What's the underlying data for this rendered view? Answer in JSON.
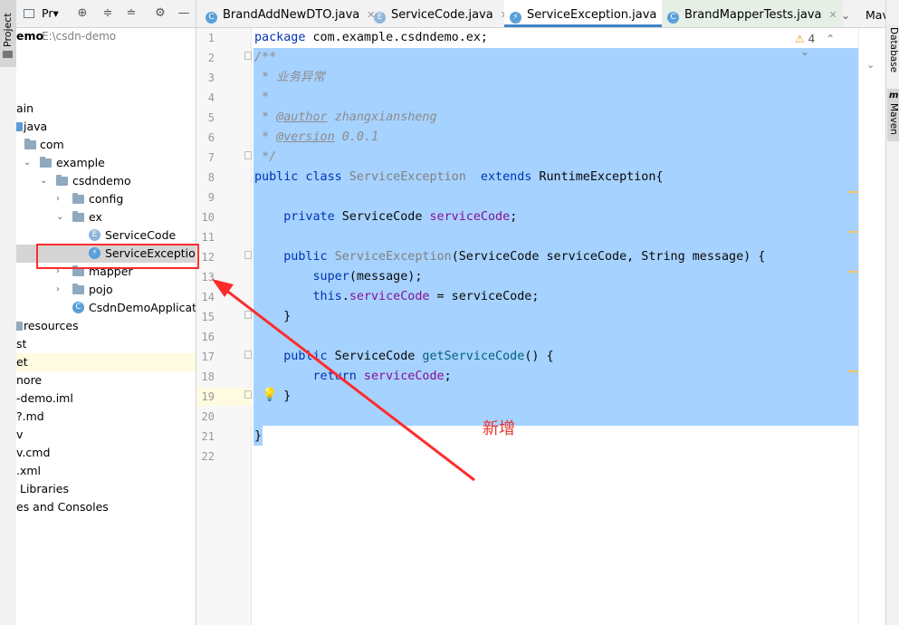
{
  "left_strip": {
    "project_tab": "Project"
  },
  "panel": {
    "title": "Pr▾",
    "path_prefix": "emo",
    "path": "E:\\csdn-demo"
  },
  "tree": [
    {
      "label": "ain"
    },
    {
      "label": "java"
    },
    {
      "label": "com"
    },
    {
      "label": "example"
    },
    {
      "label": "csdndemo"
    },
    {
      "label": "config"
    },
    {
      "label": "ex"
    },
    {
      "label": "ServiceCode"
    },
    {
      "label": "ServiceException"
    },
    {
      "label": "mapper"
    },
    {
      "label": "pojo"
    },
    {
      "label": "CsdnDemoApplicatio"
    },
    {
      "label": "resources"
    },
    {
      "label": "st"
    },
    {
      "label": "et"
    },
    {
      "label": "nore"
    },
    {
      "label": "-demo.iml"
    },
    {
      "label": "?.md"
    },
    {
      "label": "v"
    },
    {
      "label": "v.cmd"
    },
    {
      "label": ".xml"
    },
    {
      "label": "Libraries"
    },
    {
      "label": "es and Consoles"
    }
  ],
  "tabs": [
    {
      "label": "BrandAddNewDTO.java",
      "icon": "C"
    },
    {
      "label": "ServiceCode.java",
      "icon": "E"
    },
    {
      "label": "ServiceException.java",
      "icon": "⚡"
    },
    {
      "label": "BrandMapperTests.java",
      "icon": "C"
    }
  ],
  "tab_overflow": "Mav",
  "warning_count": "4",
  "line_numbers": [
    "1",
    "2",
    "3",
    "4",
    "5",
    "6",
    "7",
    "8",
    "9",
    "10",
    "11",
    "12",
    "13",
    "14",
    "15",
    "16",
    "17",
    "18",
    "19",
    "20",
    "21",
    "22"
  ],
  "code": {
    "l1_kw": "package",
    "l1_rest": " com.example.csdndemo.ex;",
    "l2": "/**",
    "l3": " * 业务异常",
    "l4": " *",
    "l5_pre": " * ",
    "l5_tag": "@author",
    "l5_rest": " zhangxiansheng",
    "l6_pre": " * ",
    "l6_tag": "@version",
    "l6_rest": " 0.0.1",
    "l7": " */",
    "l8_kw": "public class",
    "l8_name": " ServiceException",
    "l8_ext": "  extends",
    "l8_rest": " RuntimeException{",
    "l10_kw": "    private",
    "l10_type": " ServiceCode",
    "l10_fld": " serviceCode",
    "l10_end": ";",
    "l12_kw": "    public",
    "l12_name": " ServiceException",
    "l12_rest": "(ServiceCode serviceCode, String message) {",
    "l13_kw": "        super",
    "l13_rest": "(message);",
    "l14_kw": "        this",
    "l14_dot": ".",
    "l14_fld": "serviceCode",
    "l14_rest": " = serviceCode;",
    "l15": "    }",
    "l17_kw": "    public",
    "l17_type": " ServiceCode",
    "l17_fn": " getServiceCode",
    "l17_rest": "() {",
    "l18_kw": "        return",
    "l18_fld": " serviceCode",
    "l18_end": ";",
    "l19": "    }",
    "l21": "}"
  },
  "right_strip": {
    "database": "Database",
    "maven": "Maven"
  },
  "annotation": {
    "label": "新增",
    "color": "#e8332e"
  }
}
